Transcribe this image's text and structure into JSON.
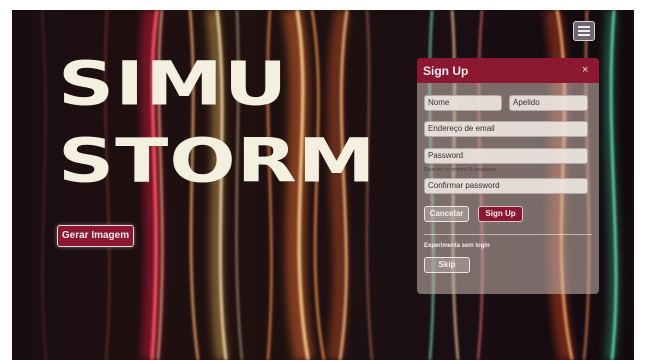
{
  "hero": {
    "line1": "SIMU",
    "line2": "STORM"
  },
  "generate_button": {
    "label": "Gerar Imagem"
  },
  "menu": {
    "icon": "hamburger-menu-icon"
  },
  "signup_panel": {
    "title": "Sign Up",
    "close_glyph": "×",
    "fields": {
      "name": "Nome",
      "surname": "Apelido",
      "email": "Endereço de email",
      "password": "Password",
      "password_hint": "Deve ter no mínimo 8 caracteres.",
      "confirm_password": "Confirmar password"
    },
    "cancel_label": "Cancelar",
    "submit_label": "Sign Up",
    "guest_label": "Experimenta sem login",
    "skip_label": "Skip"
  },
  "colors": {
    "brand": "#8c1730",
    "background": "#140b10",
    "hero_text": "#f4f0df"
  }
}
